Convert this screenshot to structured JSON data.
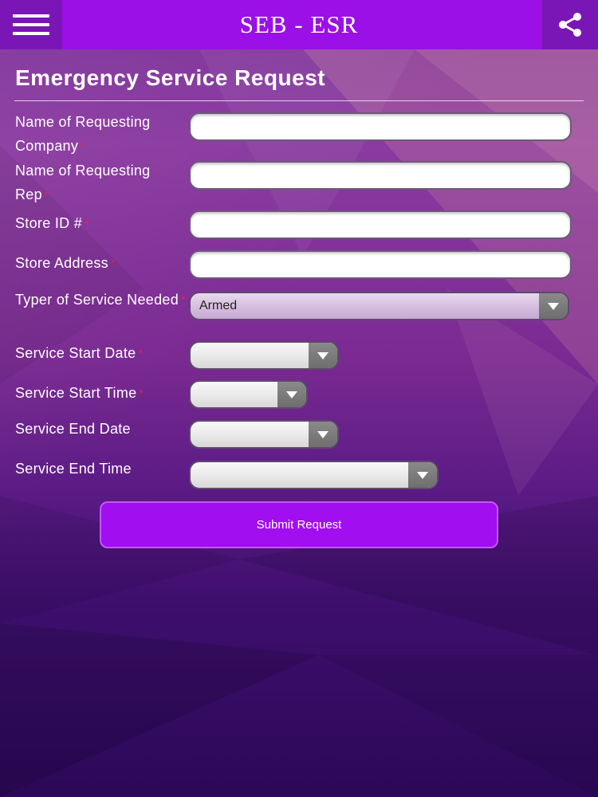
{
  "header": {
    "title": "SEB - ESR",
    "menu_icon": "hamburger-menu-icon",
    "share_icon": "share-icon"
  },
  "form": {
    "title": "Emergency Service Request",
    "required_mark": "*",
    "fields": {
      "company": {
        "label": "Name of Requesting Company",
        "value": ""
      },
      "rep": {
        "label": "Name of Requesting Rep",
        "value": ""
      },
      "store_id": {
        "label": "Store ID #",
        "value": ""
      },
      "store_address": {
        "label": "Store Address",
        "value": ""
      },
      "service_type": {
        "label": "Typer of Service Needed",
        "value": "Armed"
      },
      "start_date": {
        "label": "Service Start Date",
        "value": ""
      },
      "start_time": {
        "label": "Service Start Time",
        "value": ""
      },
      "end_date": {
        "label": "Service End Date",
        "value": ""
      },
      "end_time": {
        "label": "Service End Time",
        "value": ""
      }
    },
    "submit_label": "Submit Request"
  },
  "colors": {
    "header_bg": "#9a10e6",
    "header_button_bg": "#7b16b6",
    "submit_bg": "#a10ef0",
    "required": "#e0244a"
  }
}
